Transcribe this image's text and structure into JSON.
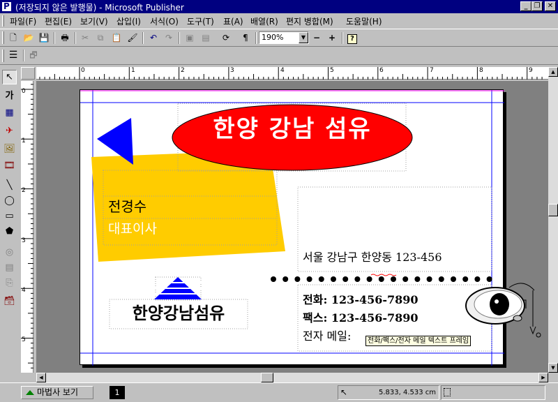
{
  "window": {
    "title": "(저장되지 않은 발행물) - Microsoft Publisher"
  },
  "menu": [
    {
      "label": "파일(F)"
    },
    {
      "label": "편집(E)"
    },
    {
      "label": "보기(V)"
    },
    {
      "label": "삽입(I)"
    },
    {
      "label": "서식(O)"
    },
    {
      "label": "도구(T)"
    },
    {
      "label": "표(A)"
    },
    {
      "label": "배열(R)"
    },
    {
      "label": "편지 병합(M)"
    },
    {
      "label": "도움말(H)"
    }
  ],
  "toolbar": {
    "zoom_value": "190%"
  },
  "ruler": {
    "h_numbers": [
      "0",
      "1",
      "2",
      "3",
      "4",
      "5",
      "6",
      "7",
      "8",
      "9"
    ],
    "v_numbers": [
      "0",
      "1",
      "2",
      "3",
      "4",
      "5"
    ]
  },
  "card": {
    "company_oval": "한양 강남 섬유",
    "name": "전경수",
    "position": "대표이사",
    "address": "서울 강남구 한양동 123-456",
    "phone": "전화: 123-456-7890",
    "fax": "팩스: 123-456-7890",
    "email_label": "전자 메일:",
    "frame_tooltip": "전화/팩스/전자 메일 텍스트 프레임",
    "logo_text": "한양강남섬유"
  },
  "statusbar": {
    "background_button": "마법사 보기",
    "page_number": "1",
    "position": "5.833, 4.533 cm"
  },
  "colors": {
    "titlebar": "#000080",
    "oval": "#ff0000",
    "yellow_block": "#ffcc00",
    "triangle": "#0000ff",
    "guide": "#0000ff"
  }
}
